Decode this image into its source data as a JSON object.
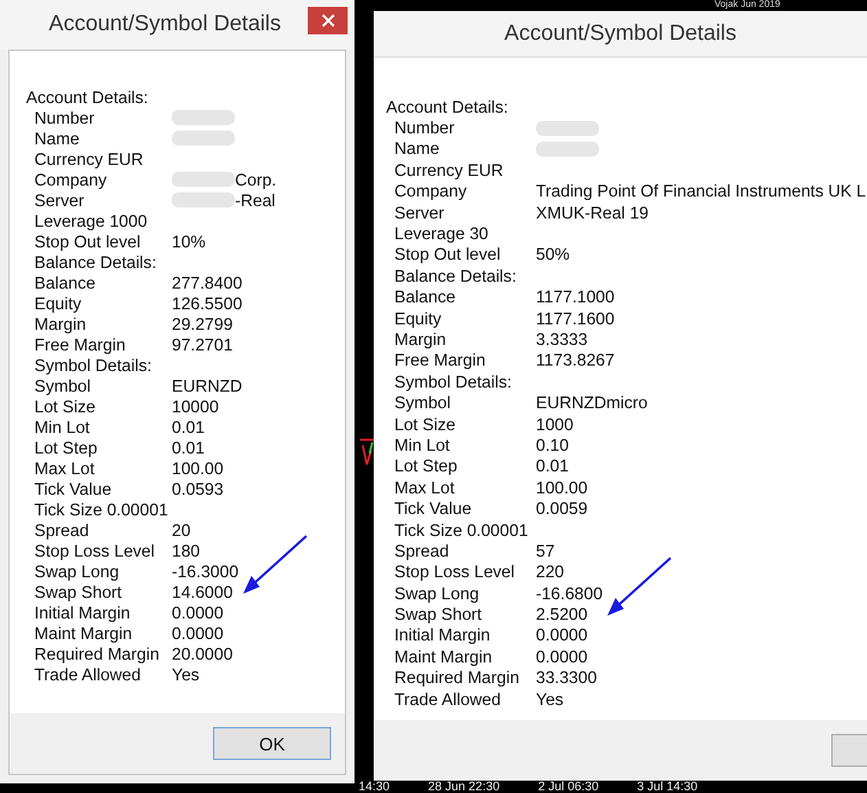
{
  "chart_labels": {
    "top": "Vojak Jun 2019",
    "axis": [
      "14:30",
      "28 Jun 22:30",
      "2 Jul 06:30",
      "3 Jul 14:30"
    ]
  },
  "dialogs": [
    {
      "title": "Account/Symbol Details",
      "close_button": true,
      "footer_button": {
        "label": "OK"
      },
      "rows": [
        {
          "kind": "heading",
          "label": "Account Details:"
        },
        {
          "kind": "pair",
          "label": "Number",
          "redacted": true
        },
        {
          "kind": "pair",
          "label": "Name",
          "redacted": true
        },
        {
          "kind": "inline",
          "label": "Currency",
          "value": "EUR"
        },
        {
          "kind": "pair",
          "label": "Company",
          "value": "Corp.",
          "redacted": true
        },
        {
          "kind": "pair",
          "label": "Server",
          "value": "-Real",
          "redacted": true
        },
        {
          "kind": "inline",
          "label": "Leverage",
          "value": "1000"
        },
        {
          "kind": "pair",
          "label": "Stop Out level",
          "value": "10%"
        },
        {
          "kind": "subheading",
          "label": "Balance Details:"
        },
        {
          "kind": "pair",
          "label": "Balance",
          "value": "277.8400"
        },
        {
          "kind": "pair",
          "label": "Equity",
          "value": "126.5500"
        },
        {
          "kind": "pair",
          "label": "Margin",
          "value": "29.2799"
        },
        {
          "kind": "pair",
          "label": "Free Margin",
          "value": "97.2701"
        },
        {
          "kind": "subheading",
          "label": "Symbol Details:"
        },
        {
          "kind": "pair",
          "label": "Symbol",
          "value": "EURNZD"
        },
        {
          "kind": "pair",
          "label": "Lot Size",
          "value": "10000"
        },
        {
          "kind": "pair",
          "label": "Min Lot",
          "value": "0.01"
        },
        {
          "kind": "pair",
          "label": "Lot Step",
          "value": "0.01"
        },
        {
          "kind": "pair",
          "label": "Max Lot",
          "value": "100.00"
        },
        {
          "kind": "pair",
          "label": "Tick Value",
          "value": "0.0593"
        },
        {
          "kind": "inline",
          "label": "Tick Size",
          "value": "0.00001"
        },
        {
          "kind": "pair",
          "label": "Spread",
          "value": "20"
        },
        {
          "kind": "pair",
          "label": "Stop Loss Level",
          "value": "180"
        },
        {
          "kind": "pair",
          "label": "Swap Long",
          "value": "-16.3000"
        },
        {
          "kind": "pair",
          "label": "Swap Short",
          "value": "14.6000",
          "arrow": true
        },
        {
          "kind": "pair",
          "label": "Initial Margin",
          "value": "0.0000"
        },
        {
          "kind": "pair",
          "label": "Maint Margin",
          "value": "0.0000"
        },
        {
          "kind": "pair",
          "label": "Required Margin",
          "value": "20.0000"
        },
        {
          "kind": "pair",
          "label": "Trade Allowed",
          "value": "Yes"
        }
      ]
    },
    {
      "title": "Account/Symbol Details",
      "close_button": false,
      "footer_button": {
        "clipped": true
      },
      "rows": [
        {
          "kind": "heading",
          "label": "Account Details:"
        },
        {
          "kind": "pair",
          "label": "Number",
          "redacted": true
        },
        {
          "kind": "pair",
          "label": "Name",
          "redacted": true
        },
        {
          "kind": "inline",
          "label": "Currency",
          "value": "EUR"
        },
        {
          "kind": "pair",
          "label": "Company",
          "value": "Trading Point Of Financial Instruments UK L"
        },
        {
          "kind": "pair",
          "label": "Server",
          "value": "XMUK-Real 19"
        },
        {
          "kind": "inline",
          "label": "Leverage",
          "value": "30"
        },
        {
          "kind": "pair",
          "label": "Stop Out level",
          "value": "50%"
        },
        {
          "kind": "subheading",
          "label": "Balance Details:"
        },
        {
          "kind": "pair",
          "label": "Balance",
          "value": "1177.1000"
        },
        {
          "kind": "pair",
          "label": "Equity",
          "value": "1177.1600"
        },
        {
          "kind": "pair",
          "label": "Margin",
          "value": "3.3333"
        },
        {
          "kind": "pair",
          "label": "Free Margin",
          "value": "1173.8267"
        },
        {
          "kind": "subheading",
          "label": "Symbol Details:"
        },
        {
          "kind": "pair",
          "label": "Symbol",
          "value": "EURNZDmicro"
        },
        {
          "kind": "pair",
          "label": "Lot Size",
          "value": "1000"
        },
        {
          "kind": "pair",
          "label": "Min Lot",
          "value": "0.10"
        },
        {
          "kind": "pair",
          "label": "Lot Step",
          "value": "0.01"
        },
        {
          "kind": "pair",
          "label": "Max Lot",
          "value": "100.00"
        },
        {
          "kind": "pair",
          "label": "Tick Value",
          "value": "0.0059"
        },
        {
          "kind": "inline",
          "label": "Tick Size",
          "value": "0.00001"
        },
        {
          "kind": "pair",
          "label": "Spread",
          "value": "57"
        },
        {
          "kind": "pair",
          "label": "Stop Loss Level",
          "value": "220"
        },
        {
          "kind": "pair",
          "label": "Swap Long",
          "value": "-16.6800"
        },
        {
          "kind": "pair",
          "label": "Swap Short",
          "value": "2.5200",
          "arrow": true
        },
        {
          "kind": "pair",
          "label": "Initial Margin",
          "value": "0.0000"
        },
        {
          "kind": "pair",
          "label": "Maint Margin",
          "value": "0.0000"
        },
        {
          "kind": "pair",
          "label": "Required Margin",
          "value": "33.3300"
        },
        {
          "kind": "pair",
          "label": "Trade Allowed",
          "value": "Yes"
        }
      ]
    }
  ]
}
